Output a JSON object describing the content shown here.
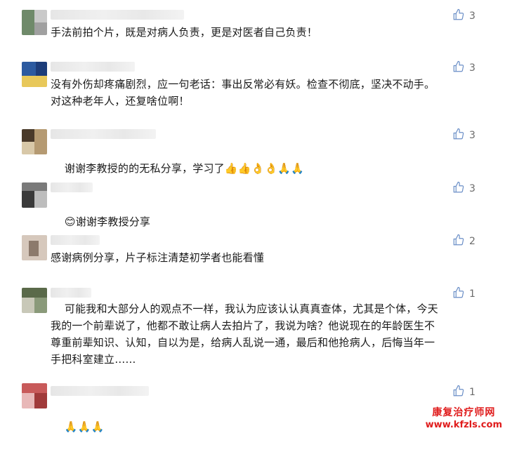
{
  "comments": [
    {
      "text": "手法前拍个片，既是对病人负责，更是对医者自己负责！",
      "likes": "3",
      "avatar_colors": [
        "#6f8a6a",
        "#c9c9c9",
        "#a0a0a0"
      ],
      "name_width": "fixed"
    },
    {
      "text": "没有外伤却疼痛剧烈，应一句老话：事出反常必有妖。检查不彻底，坚决不动手。\n对这种老年人，还复啥位啊！",
      "likes": "3",
      "avatar_colors": [
        "#2c5aa0",
        "#1d3d7a",
        "#e8c85a"
      ],
      "name_width": "fixed"
    },
    {
      "text": "谢谢李教授的的无私分享，学习了",
      "emoji": "👍👍👌👌🙏🙏",
      "likes": "3",
      "avatar_colors": [
        "#4a3a2a",
        "#b59a72",
        "#d8c8a8"
      ],
      "name_width": "fixed"
    },
    {
      "text": "谢谢李教授分享",
      "emoji_prefix": "😊",
      "likes": "3",
      "avatar_colors": [
        "#7a7a7a",
        "#3a3a3a",
        "#bdbdbd"
      ],
      "name_width": "fixed"
    },
    {
      "text": "感谢病例分享，片子标注清楚初学者也能看懂",
      "likes": "2",
      "avatar_colors": [
        "#b8a89a",
        "#d6c8bc",
        "#8c7a6c"
      ],
      "name_width": "fixed"
    },
    {
      "text": "    可能我和大部分人的观点不一样，我认为应该认认真真查体，尤其是个体，今天\n我的一个前辈说了，他都不敢让病人去拍片了，我说为啥？他说现在的年龄医生不\n尊重前辈知识、认知，自以为是，给病人乱说一通，最后和他抢病人，后悔当年一\n手把科室建立……",
      "likes": "1",
      "avatar_colors": [
        "#5a6a4a",
        "#c8c8b8",
        "#8a9a7a"
      ],
      "name_width": "fixed"
    },
    {
      "text": "",
      "emoji": "🙏🙏🙏",
      "likes": "1",
      "avatar_colors": [
        "#c85a5a",
        "#e8b8b8",
        "#a03a3a"
      ],
      "name_width": "fixed"
    }
  ],
  "watermark": {
    "line1": "康复治疗师网",
    "line2": "www.kfzls.com"
  }
}
